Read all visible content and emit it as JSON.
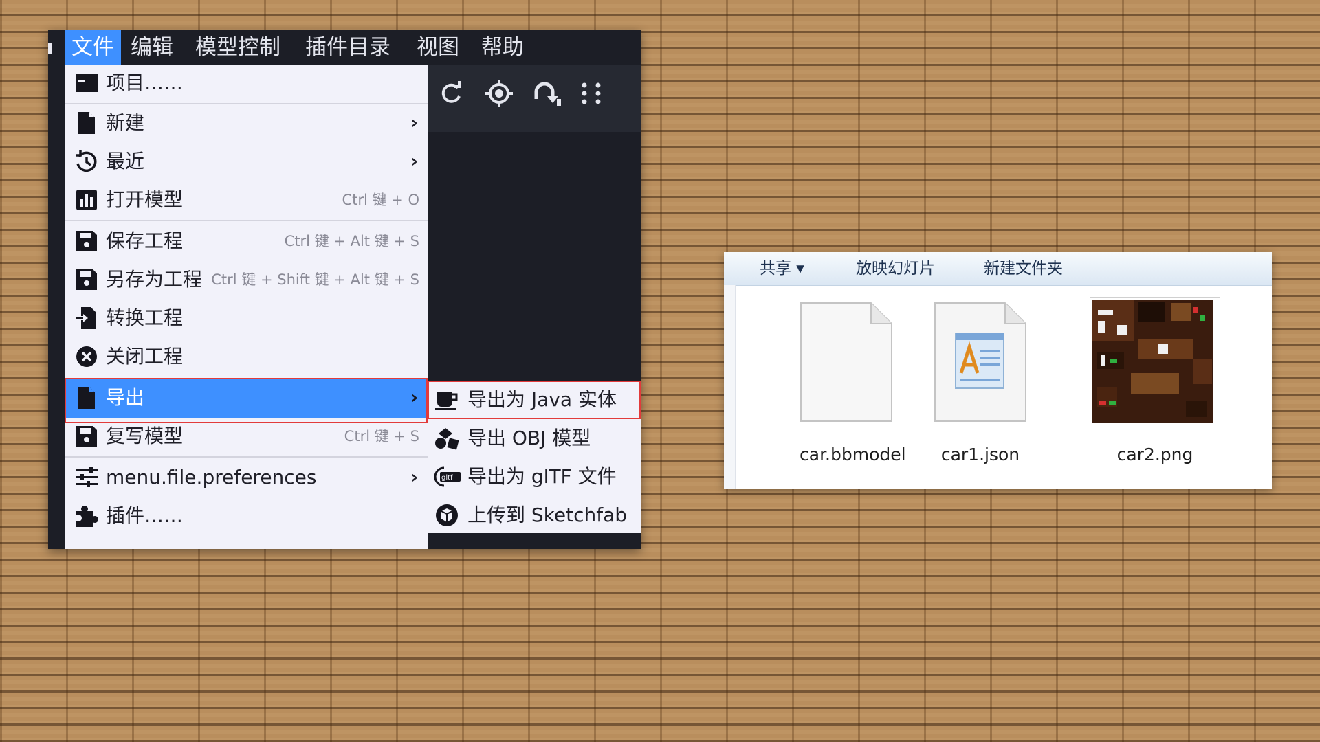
{
  "menubar": {
    "items": [
      {
        "label": "文件",
        "active": true
      },
      {
        "label": "编辑"
      },
      {
        "label": "模型控制"
      },
      {
        "label": "插件目录"
      },
      {
        "label": "视图"
      },
      {
        "label": "帮助"
      }
    ]
  },
  "toolbar": {
    "icons": [
      "refresh-icon",
      "target-icon",
      "rotate-arrow-icon",
      "more-vertical-icon"
    ]
  },
  "file_menu": {
    "items": [
      {
        "label": "项目……",
        "icon": "project-window-icon"
      },
      {
        "label": "新建",
        "icon": "new-file-icon",
        "has_submenu": true
      },
      {
        "label": "最近",
        "icon": "history-icon",
        "has_submenu": true
      },
      {
        "label": "打开模型",
        "icon": "bar-chart-icon",
        "shortcut": "Ctrl 键 + O"
      },
      {
        "label": "保存工程",
        "icon": "floppy-disk-icon",
        "shortcut": "Ctrl 键 + Alt 键 + S"
      },
      {
        "label": "另存为工程",
        "icon": "floppy-disk-icon",
        "shortcut": "Ctrl 键 + Shift 键 + Alt 键 + S"
      },
      {
        "label": "转换工程",
        "icon": "file-import-icon"
      },
      {
        "label": "关闭工程",
        "icon": "close-circle-icon"
      },
      {
        "label": "导出",
        "icon": "file-icon",
        "has_submenu": true,
        "highlighted": true
      },
      {
        "label": "复写模型",
        "icon": "floppy-disk-icon",
        "shortcut": "Ctrl 键 + S"
      },
      {
        "label": "menu.file.preferences",
        "icon": "sliders-icon",
        "has_submenu": true
      },
      {
        "label": "插件……",
        "icon": "puzzle-piece-icon"
      }
    ]
  },
  "export_submenu": {
    "items": [
      {
        "label": "导出为 Java 实体",
        "icon": "coffee-cup-icon"
      },
      {
        "label": "导出 OBJ 模型",
        "icon": "shapes-icon"
      },
      {
        "label": "导出为 glTF 文件",
        "icon": "gltf-logo-icon",
        "badge": "gltf"
      },
      {
        "label": "上传到 Sketchfab",
        "icon": "sketchfab-logo-icon"
      }
    ]
  },
  "explorer": {
    "toolbar": {
      "share": "共享 ▾",
      "slideshow": "放映幻灯片",
      "new_folder": "新建文件夹"
    },
    "files": [
      {
        "name": "car.bbmodel",
        "icon": "blank-document-icon"
      },
      {
        "name": "car1.json",
        "icon": "text-document-icon"
      },
      {
        "name": "car2.png",
        "icon": "texture-thumbnail"
      }
    ]
  },
  "colors": {
    "accent": "#3e90ff",
    "highlight_border": "#e23b3b",
    "dark_bg": "#1c1e26",
    "menu_bg": "#f2f2fa"
  }
}
